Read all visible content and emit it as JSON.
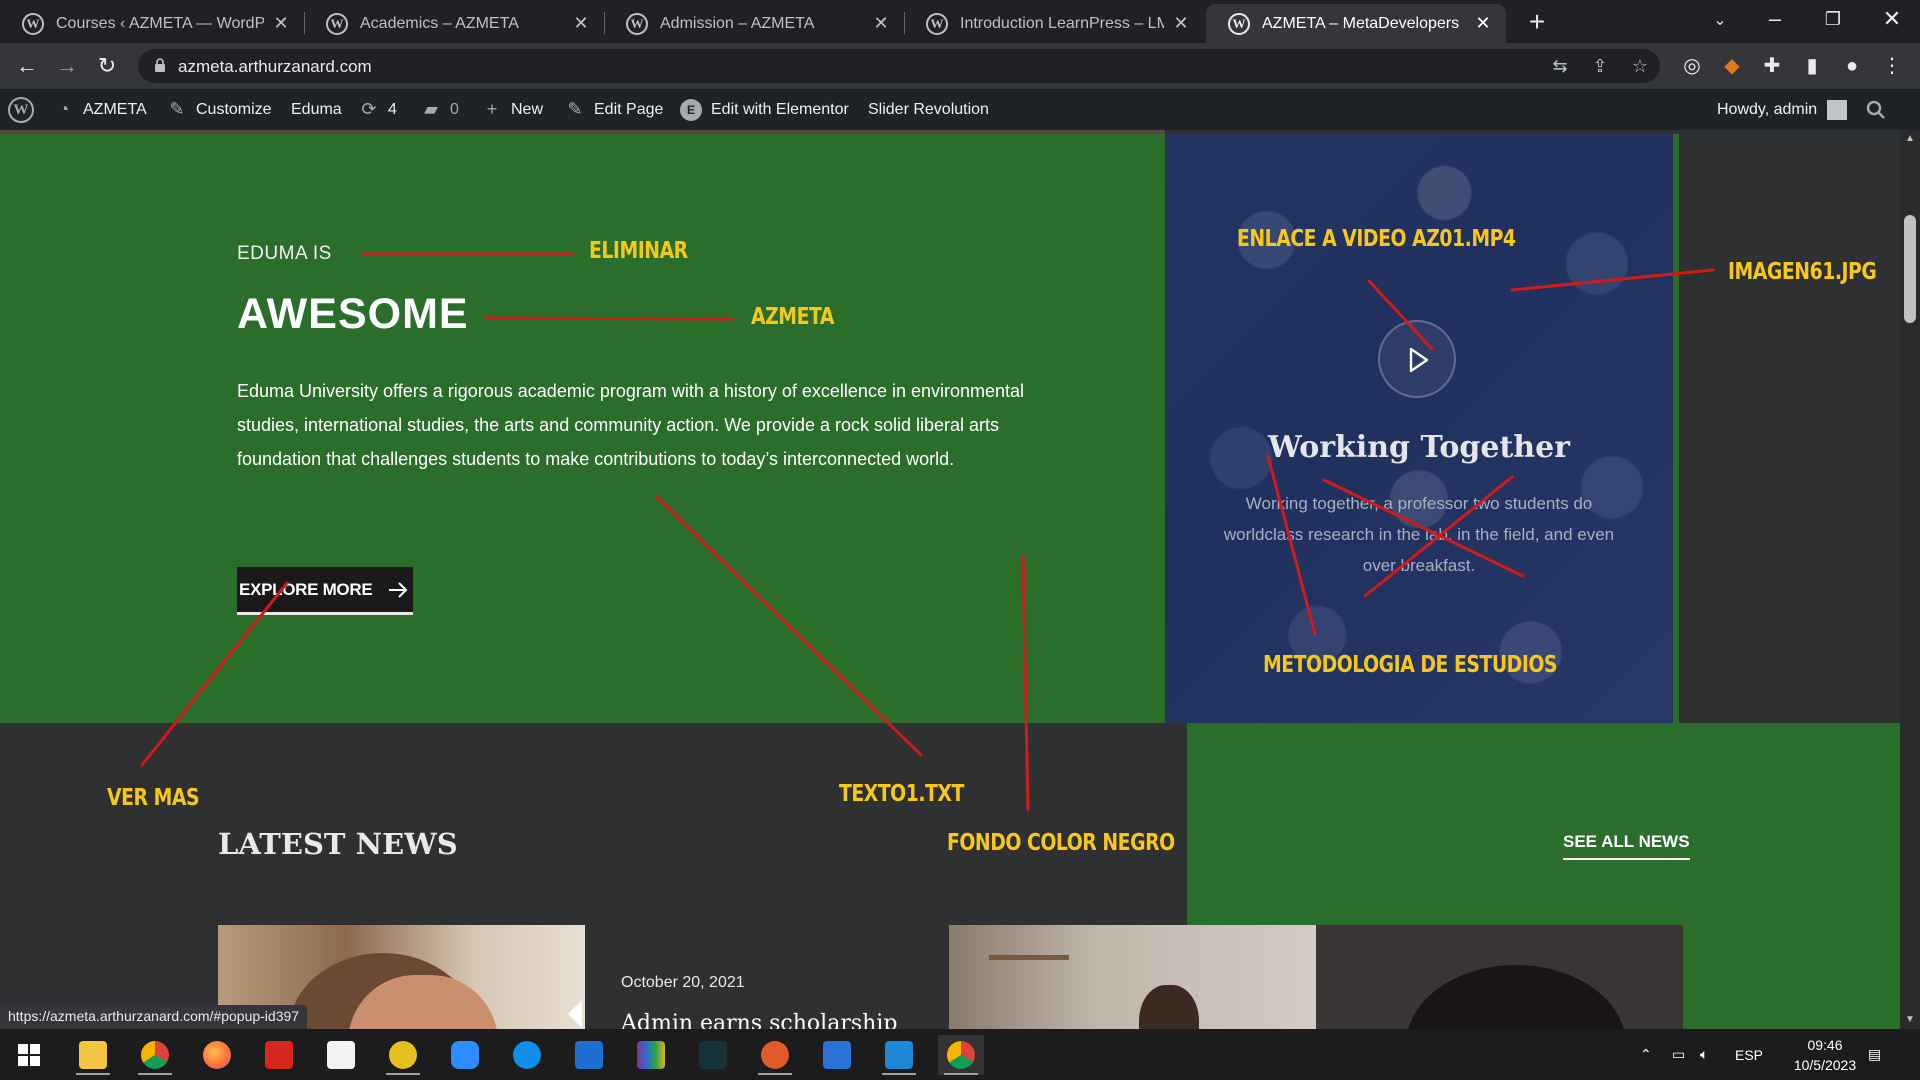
{
  "browser": {
    "tabs": [
      {
        "title": "Courses ‹ AZMETA — WordPress",
        "active": false
      },
      {
        "title": "Academics – AZMETA",
        "active": false
      },
      {
        "title": "Admission – AZMETA",
        "active": false
      },
      {
        "title": "Introduction LearnPress – LMS pl",
        "active": false
      },
      {
        "title": "AZMETA – MetaDevelopers",
        "active": true
      }
    ],
    "tab_close": "✕",
    "new_tab": "+",
    "url": "azmeta.arthurzanard.com",
    "status_url": "https://azmeta.arthurzanard.com/#popup-id397"
  },
  "admin_bar": {
    "site_name": "AZMETA",
    "customize": "Customize",
    "theme": "Eduma",
    "updates_count": "4",
    "comments_count": "0",
    "new_label": "New",
    "edit_page": "Edit Page",
    "elementor": "Edit with Elementor",
    "slider": "Slider Revolution",
    "howdy": "Howdy, admin"
  },
  "hero": {
    "eyebrow": "EDUMA IS",
    "headline": "AWESOME",
    "body": "Eduma University offers a rigorous academic program with a history of excellence in environmental studies, international studies, the arts and community action. We provide a rock solid liberal arts foundation that challenges students to make contributions to today’s interconnected world.",
    "button_label": "EXPLORE MORE"
  },
  "video_card": {
    "title": "Working Together",
    "text": "Working together, a professor two students do worldclass research in the lab, in the field, and even over breakfast."
  },
  "news": {
    "section_title": "LATEST NEWS",
    "see_all": "SEE ALL NEWS",
    "first_date": "October 20, 2021",
    "first_title": "Admin earns scholarship"
  },
  "annotations": {
    "eliminar": "ELIMINAR",
    "azmeta": "AZMETA",
    "enlace_video": "ENLACE A VIDEO AZ01.MP4",
    "imagen": "IMAGEN61.JPG",
    "metodologia": "METODOLOGIA DE ESTUDIOS",
    "ver_mas": "VER MAS",
    "texto": "TEXTO1.TXT",
    "fondo": "FONDO COLOR NEGRO",
    "line_color": "#d11a1a",
    "text_color": "#f7c81b"
  },
  "taskbar": {
    "language": "ESP",
    "time": "09:46",
    "date": "10/5/2023"
  },
  "colors": {
    "hero_green": "#2b6e2c",
    "dark_bg": "#2e3032",
    "admin_bar": "#1d2327"
  }
}
